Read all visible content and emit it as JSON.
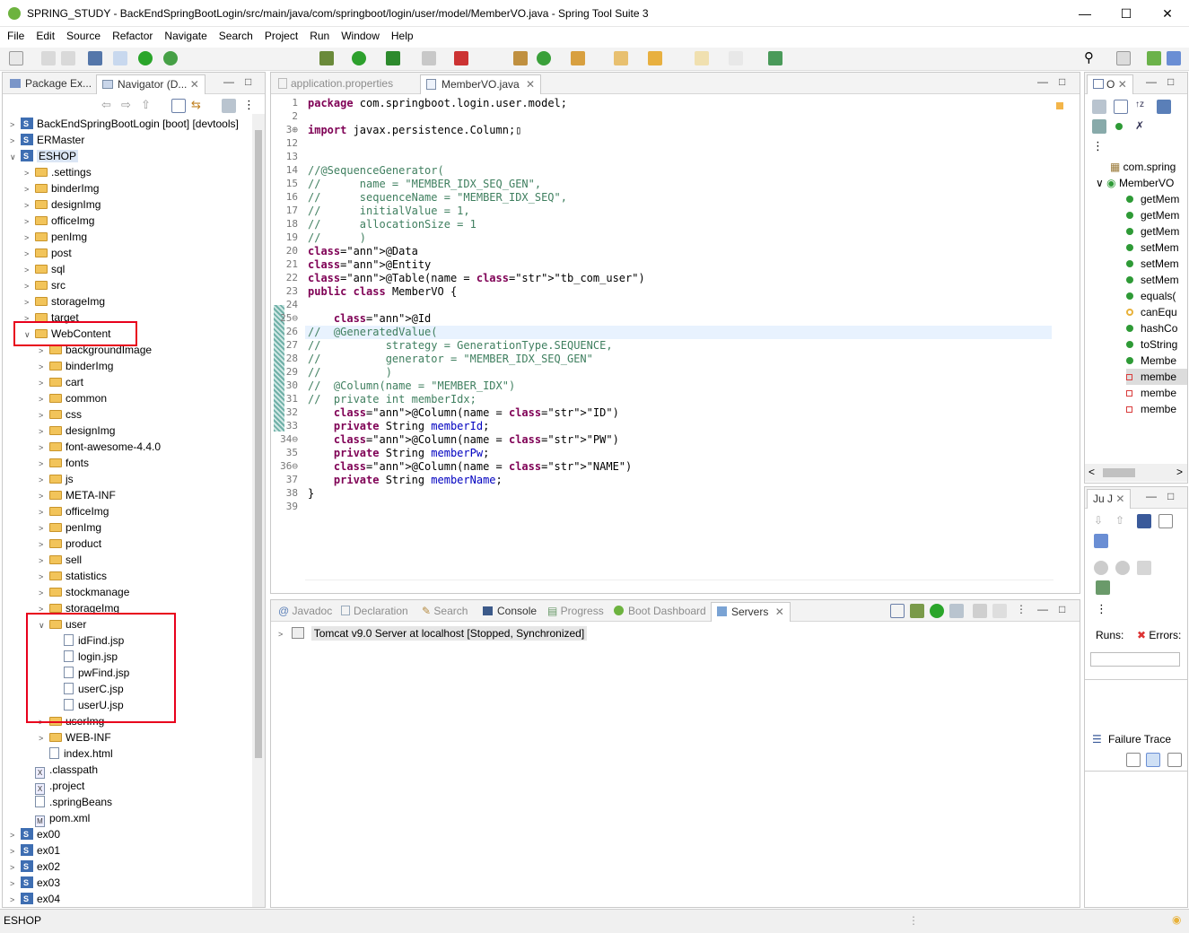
{
  "window": {
    "title": "SPRING_STUDY - BackEndSpringBootLogin/src/main/java/com/springboot/login/user/model/MemberVO.java - Spring Tool Suite 3"
  },
  "menu": [
    "File",
    "Edit",
    "Source",
    "Refactor",
    "Navigate",
    "Search",
    "Project",
    "Run",
    "Window",
    "Help"
  ],
  "left_tabs": {
    "package_explorer": "Package Ex...",
    "navigator": "Navigator (D..."
  },
  "tree": [
    {
      "label": "BackEndSpringBootLogin [boot] [devtools]",
      "type": "project",
      "depth": 0,
      "expanded": false
    },
    {
      "label": "ERMaster",
      "type": "project",
      "depth": 0,
      "expanded": false
    },
    {
      "label": "ESHOP",
      "type": "project",
      "depth": 0,
      "expanded": true,
      "selected": true
    },
    {
      "label": ".settings",
      "type": "folder",
      "depth": 1,
      "expanded": false
    },
    {
      "label": "binderImg",
      "type": "folder",
      "depth": 1,
      "expanded": false
    },
    {
      "label": "designImg",
      "type": "folder",
      "depth": 1,
      "expanded": false
    },
    {
      "label": "officeImg",
      "type": "folder",
      "depth": 1,
      "expanded": false
    },
    {
      "label": "penImg",
      "type": "folder",
      "depth": 1,
      "expanded": false
    },
    {
      "label": "post",
      "type": "folder",
      "depth": 1,
      "expanded": false
    },
    {
      "label": "sql",
      "type": "folder",
      "depth": 1,
      "expanded": false
    },
    {
      "label": "src",
      "type": "folder",
      "depth": 1,
      "expanded": false
    },
    {
      "label": "storageImg",
      "type": "folder",
      "depth": 1,
      "expanded": false
    },
    {
      "label": "target",
      "type": "folder",
      "depth": 1,
      "expanded": false
    },
    {
      "label": "WebContent",
      "type": "folder",
      "depth": 1,
      "expanded": true
    },
    {
      "label": "backgroundImage",
      "type": "folder",
      "depth": 2,
      "expanded": false
    },
    {
      "label": "binderImg",
      "type": "folder",
      "depth": 2,
      "expanded": false
    },
    {
      "label": "cart",
      "type": "folder",
      "depth": 2,
      "expanded": false
    },
    {
      "label": "common",
      "type": "folder",
      "depth": 2,
      "expanded": false
    },
    {
      "label": "css",
      "type": "folder",
      "depth": 2,
      "expanded": false
    },
    {
      "label": "designImg",
      "type": "folder",
      "depth": 2,
      "expanded": false
    },
    {
      "label": "font-awesome-4.4.0",
      "type": "folder",
      "depth": 2,
      "expanded": false
    },
    {
      "label": "fonts",
      "type": "folder",
      "depth": 2,
      "expanded": false
    },
    {
      "label": "js",
      "type": "folder",
      "depth": 2,
      "expanded": false
    },
    {
      "label": "META-INF",
      "type": "folder",
      "depth": 2,
      "expanded": false
    },
    {
      "label": "officeImg",
      "type": "folder",
      "depth": 2,
      "expanded": false
    },
    {
      "label": "penImg",
      "type": "folder",
      "depth": 2,
      "expanded": false
    },
    {
      "label": "product",
      "type": "folder",
      "depth": 2,
      "expanded": false
    },
    {
      "label": "sell",
      "type": "folder",
      "depth": 2,
      "expanded": false
    },
    {
      "label": "statistics",
      "type": "folder",
      "depth": 2,
      "expanded": false
    },
    {
      "label": "stockmanage",
      "type": "folder",
      "depth": 2,
      "expanded": false
    },
    {
      "label": "storageImg",
      "type": "folder",
      "depth": 2,
      "expanded": false
    },
    {
      "label": "user",
      "type": "folder",
      "depth": 2,
      "expanded": true
    },
    {
      "label": "idFind.jsp",
      "type": "file",
      "depth": 3
    },
    {
      "label": "login.jsp",
      "type": "file",
      "depth": 3
    },
    {
      "label": "pwFind.jsp",
      "type": "file",
      "depth": 3
    },
    {
      "label": "userC.jsp",
      "type": "file",
      "depth": 3
    },
    {
      "label": "userU.jsp",
      "type": "file",
      "depth": 3
    },
    {
      "label": "userImg",
      "type": "folder",
      "depth": 2,
      "expanded": false
    },
    {
      "label": "WEB-INF",
      "type": "folder",
      "depth": 2,
      "expanded": false
    },
    {
      "label": "index.html",
      "type": "file",
      "depth": 2
    },
    {
      "label": ".classpath",
      "type": "xml",
      "depth": 1
    },
    {
      "label": ".project",
      "type": "xml",
      "depth": 1
    },
    {
      "label": ".springBeans",
      "type": "file",
      "depth": 1
    },
    {
      "label": "pom.xml",
      "type": "xml",
      "depth": 1
    },
    {
      "label": "ex00",
      "type": "project",
      "depth": 0,
      "expanded": false
    },
    {
      "label": "ex01",
      "type": "project",
      "depth": 0,
      "expanded": false
    },
    {
      "label": "ex02",
      "type": "project",
      "depth": 0,
      "expanded": false
    },
    {
      "label": "ex03",
      "type": "project",
      "depth": 0,
      "expanded": false
    },
    {
      "label": "ex04",
      "type": "project",
      "depth": 0,
      "expanded": false
    }
  ],
  "editor_tabs": {
    "tab1": "application.properties",
    "tab2": "MemberVO.java"
  },
  "code": [
    {
      "n": "1",
      "t": "package com.springboot.login.user.model;"
    },
    {
      "n": "2",
      "t": ""
    },
    {
      "n": "3⊕",
      "t": "import javax.persistence.Column;▯"
    },
    {
      "n": "12",
      "t": ""
    },
    {
      "n": "13",
      "t": ""
    },
    {
      "n": "14",
      "t": "//@SequenceGenerator("
    },
    {
      "n": "15",
      "t": "//      name = \"MEMBER_IDX_SEQ_GEN\","
    },
    {
      "n": "16",
      "t": "//      sequenceName = \"MEMBER_IDX_SEQ\","
    },
    {
      "n": "17",
      "t": "//      initialValue = 1,"
    },
    {
      "n": "18",
      "t": "//      allocationSize = 1"
    },
    {
      "n": "19",
      "t": "//      )"
    },
    {
      "n": "20",
      "t": "@Data"
    },
    {
      "n": "21",
      "t": "@Entity"
    },
    {
      "n": "22",
      "t": "@Table(name = \"tb_com_user\")"
    },
    {
      "n": "23",
      "t": "public class MemberVO {"
    },
    {
      "n": "24",
      "t": ""
    },
    {
      "n": "25⊖",
      "t": "    @Id"
    },
    {
      "n": "26",
      "t": "//  @GeneratedValue("
    },
    {
      "n": "27",
      "t": "//          strategy = GenerationType.SEQUENCE,"
    },
    {
      "n": "28",
      "t": "//          generator = \"MEMBER_IDX_SEQ_GEN\""
    },
    {
      "n": "29",
      "t": "//          )"
    },
    {
      "n": "30",
      "t": "//  @Column(name = \"MEMBER_IDX\")"
    },
    {
      "n": "31",
      "t": "//  private int memberIdx;"
    },
    {
      "n": "32",
      "t": "    @Column(name = \"ID\")"
    },
    {
      "n": "33",
      "t": "    private String memberId;"
    },
    {
      "n": "34⊖",
      "t": "    @Column(name = \"PW\")"
    },
    {
      "n": "35",
      "t": "    private String memberPw;"
    },
    {
      "n": "36⊖",
      "t": "    @Column(name = \"NAME\")"
    },
    {
      "n": "37",
      "t": "    private String memberName;"
    },
    {
      "n": "38",
      "t": "}"
    },
    {
      "n": "39",
      "t": ""
    }
  ],
  "bottom_tabs": [
    "Javadoc",
    "Declaration",
    "Search",
    "Console",
    "Progress",
    "Boot Dashboard",
    "Servers"
  ],
  "servers": {
    "entry": "Tomcat v9.0 Server at localhost  [Stopped, Synchronized]"
  },
  "outline": {
    "tab": "O",
    "items": [
      {
        "label": "com.spring",
        "kind": "package"
      },
      {
        "label": "MemberVO",
        "kind": "class"
      },
      {
        "label": "getMem",
        "kind": "method"
      },
      {
        "label": "getMem",
        "kind": "method"
      },
      {
        "label": "getMem",
        "kind": "method"
      },
      {
        "label": "setMem",
        "kind": "method"
      },
      {
        "label": "setMem",
        "kind": "method"
      },
      {
        "label": "setMem",
        "kind": "method"
      },
      {
        "label": "equals(",
        "kind": "method"
      },
      {
        "label": "canEqu",
        "kind": "protected"
      },
      {
        "label": "hashCo",
        "kind": "method"
      },
      {
        "label": "toString",
        "kind": "method"
      },
      {
        "label": "Membe",
        "kind": "ctor"
      },
      {
        "label": "membe",
        "kind": "field",
        "selected": true
      },
      {
        "label": "membe",
        "kind": "field"
      },
      {
        "label": "membe",
        "kind": "field"
      }
    ]
  },
  "junit": {
    "tab": "Ju J",
    "runs_label": "Runs:",
    "errors_label": "Errors:",
    "failure_trace": "Failure Trace"
  },
  "status": {
    "text": "ESHOP"
  }
}
